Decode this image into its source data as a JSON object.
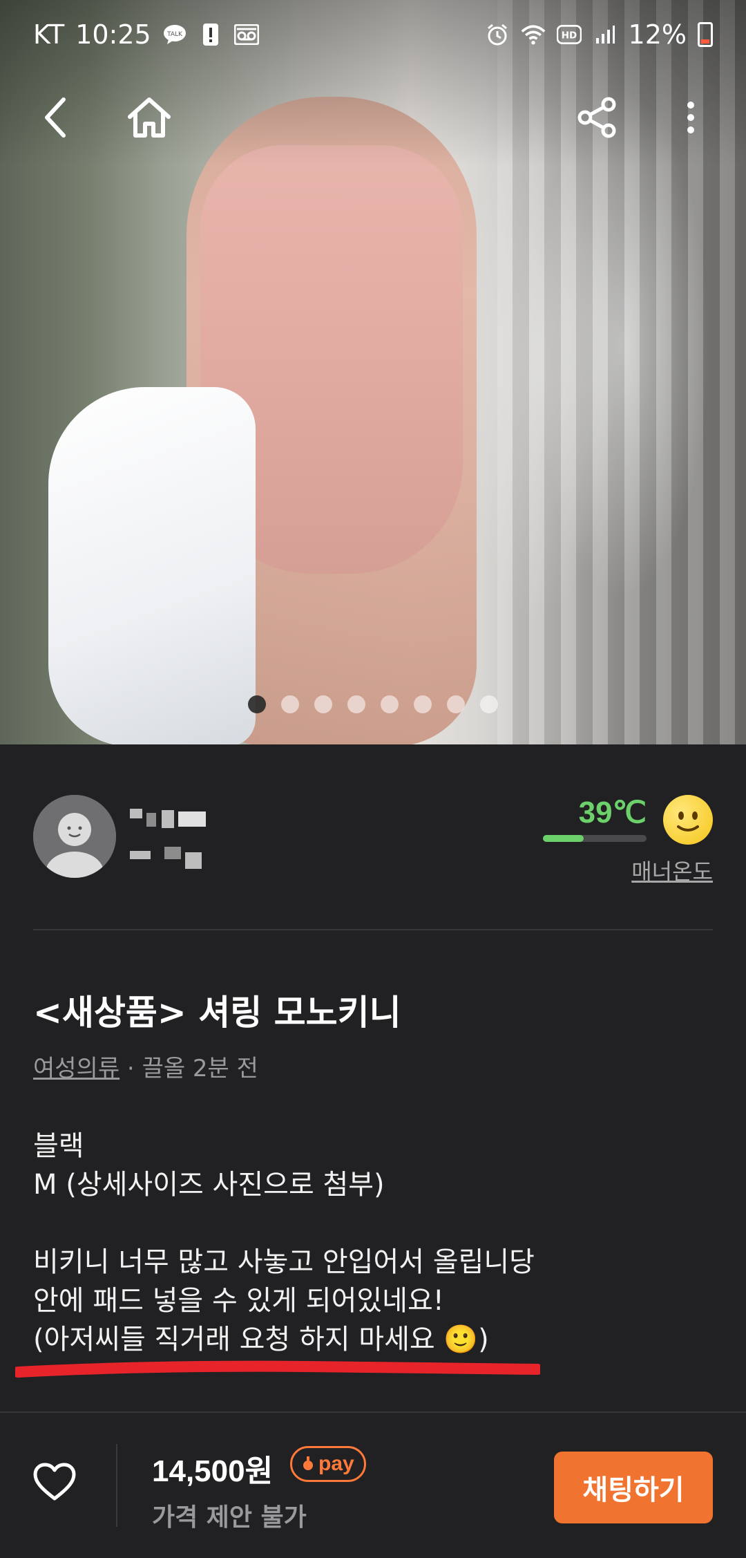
{
  "status_bar": {
    "carrier": "KT",
    "time": "10:25",
    "battery": "12%",
    "left_icons": [
      "talk-icon",
      "alert-icon",
      "voicemail-icon"
    ],
    "right_icons": [
      "alarm-icon",
      "wifi-icon",
      "hd-icon",
      "signal-icon",
      "battery-icon"
    ]
  },
  "nav": {
    "back_icon": "chevron-left-icon",
    "home_icon": "home-icon",
    "share_icon": "share-icon",
    "more_icon": "more-vertical-icon"
  },
  "carousel": {
    "total": 8,
    "active_index": 0
  },
  "seller": {
    "manner_temp": "39℃",
    "manner_temp_level": 0.39,
    "manner_label": "매너온도",
    "emoji": "smile-emoji"
  },
  "product": {
    "title": "<새상품> 셔링 모노키니",
    "category": "여성의류",
    "meta_sep": " · ",
    "time_ago": "끌올 2분 전",
    "description": {
      "line1": "블랙",
      "line2": "M (상세사이즈 사진으로 첨부)",
      "line3": "비키니 너무 많고 사놓고 안입어서 올립니당",
      "line4": "안에 패드 넣을 수 있게 되어있네요!",
      "line5": "(아저씨들 직거래 요청 하지 마세요 🙂)"
    }
  },
  "bottom_bar": {
    "price": "14,500원",
    "pay_label": "pay",
    "price_note": "가격 제안 불가",
    "chat_button": "채팅하기"
  },
  "colors": {
    "background": "#212123",
    "accent": "#f0732f",
    "temp_green": "#6cd06b",
    "underline_red": "#e8242b"
  }
}
